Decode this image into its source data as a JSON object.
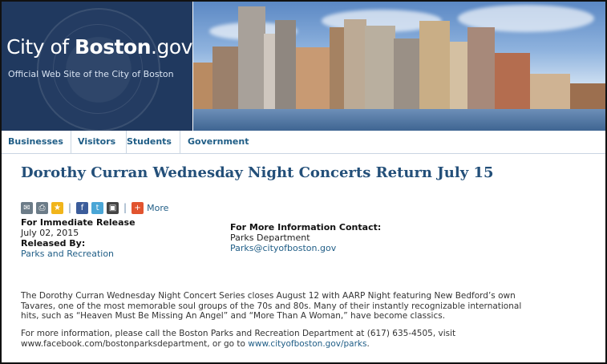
{
  "header": {
    "brand_city": "City of ",
    "brand_bold": "Boston",
    "brand_suffix": ".gov",
    "tagline": "Official Web Site of the City of Boston"
  },
  "nav": {
    "items": [
      "Businesses",
      "Visitors",
      "Students",
      "Government"
    ]
  },
  "page": {
    "title": "Dorothy Curran Wednesday Night Concerts Return July 15"
  },
  "share": {
    "sep1": "|",
    "sep2": "|",
    "more": "More",
    "icons": [
      "email-icon",
      "print-icon",
      "star-icon",
      "facebook-icon",
      "twitter-icon",
      "delicious-icon",
      "plus-icon"
    ]
  },
  "release": {
    "label": "For Immediate Release",
    "date": "July 02, 2015",
    "released_by_label": "Released By:",
    "released_by": "Parks and Recreation"
  },
  "contact": {
    "label": "For More Information Contact:",
    "name": "Parks Department",
    "email": "Parks@cityofboston.gov"
  },
  "body": {
    "p1_line1": "The Dorothy Curran Wednesday Night Concert Series closes August 12 with AARP Night featuring New Bedford’s own",
    "p1_line2": "Tavares, one of the most memorable soul groups of the 70s and 80s.  Many of their instantly recognizable international",
    "p1_line3": "hits, such as “Heaven Must Be Missing An Angel” and “More Than A Woman,” have become classics.",
    "p2_line1": "For more information, please call the Boston Parks and Recreation Department at (617) 635-4505, visit",
    "p2_line2_prefix": "www.facebook.com/bostonparksdepartment, or go to ",
    "p2_link": "www.cityofboston.gov/parks",
    "p2_suffix": "."
  },
  "colors": {
    "accent": "#1f5d86",
    "title": "#234f79",
    "seal_panel": "#20395f"
  }
}
